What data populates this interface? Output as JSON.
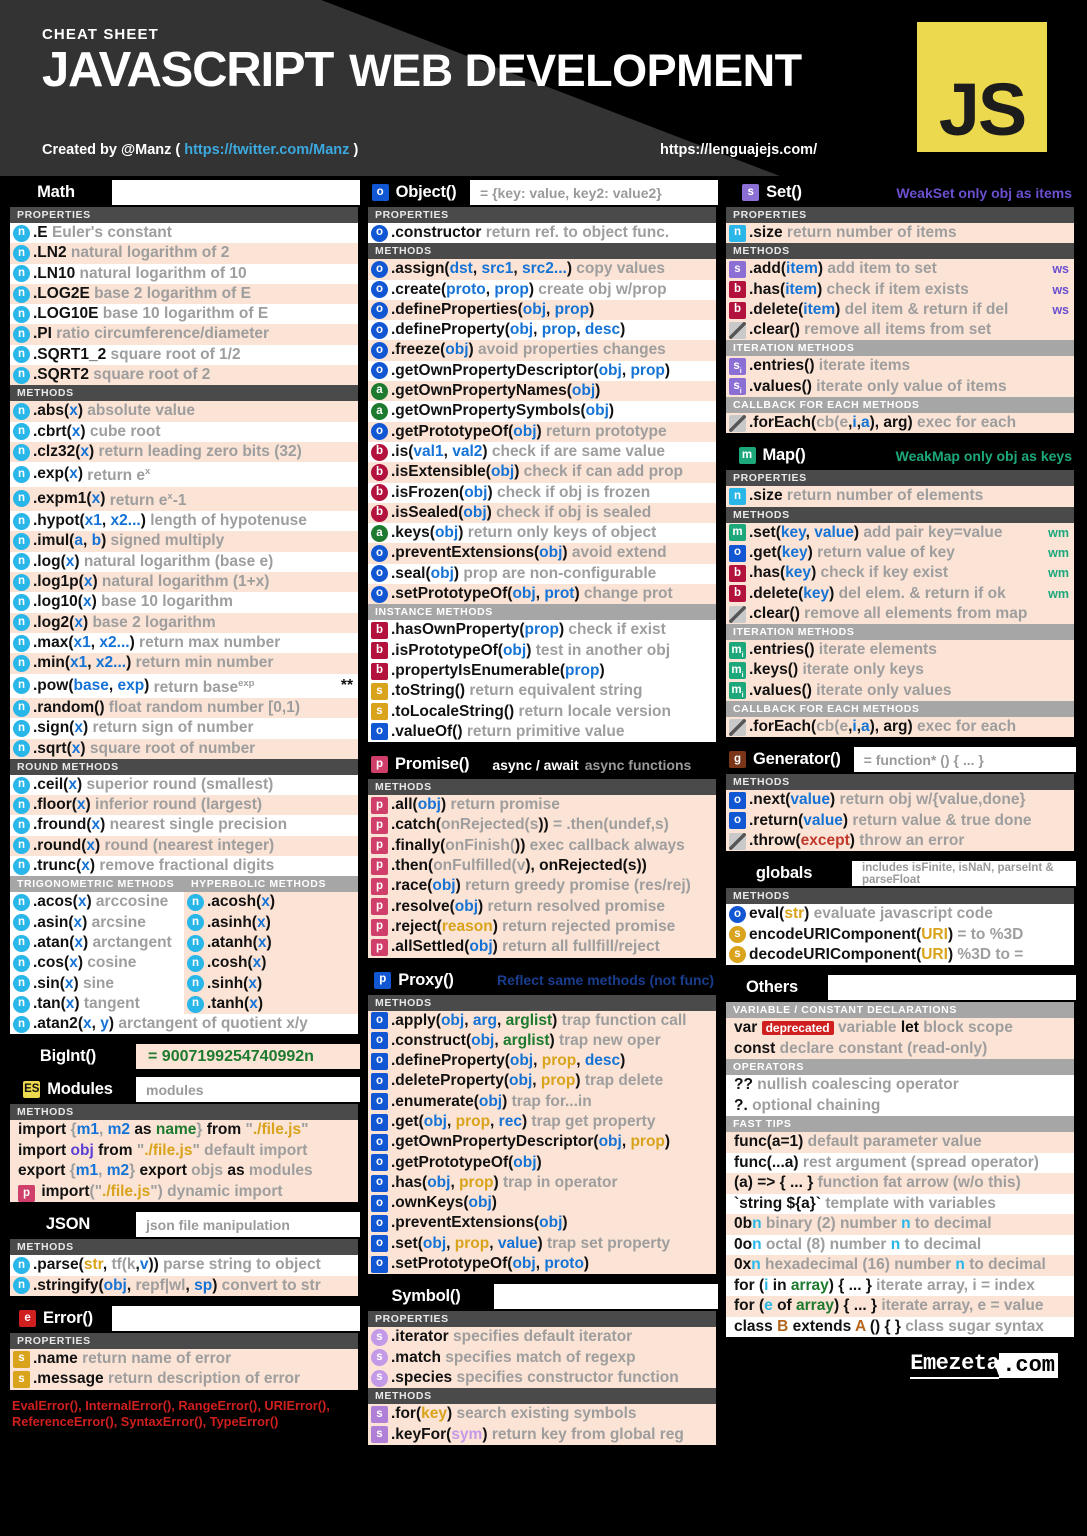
{
  "header": {
    "cheat_label": "CHEAT SHEET",
    "title_bold": "JAVASCRIPT",
    "title_light": "WEB DEVELOPMENT",
    "created_prefix": "Created by @Manz (",
    "created_link": "https://twitter.com/Manz",
    "created_suffix": ")",
    "site_url": "https://lenguajejs.com/",
    "js_logo": "JS"
  },
  "labels": {
    "properties": "PROPERTIES",
    "methods": "METHODS",
    "round_methods": "ROUND METHODS",
    "trig_methods": "TRIGONOMETRIC METHODS",
    "hyperbolic_methods": "HYPERBOLIC METHODS",
    "instance_methods": "INSTANCE METHODS",
    "iteration_methods": "ITERATION METHODS",
    "callback_methods": "CALLBACK FOR EACH METHODS",
    "var_const_decl": "VARIABLE / CONSTANT DECLARATIONS",
    "operators": "OPERATORS",
    "fast_tips": "FAST TIPS"
  },
  "math": {
    "title": "Math",
    "properties": [
      {
        "badge": "n",
        "name": ".E",
        "desc": "Euler's constant"
      },
      {
        "badge": "n",
        "name": ".LN2",
        "desc": "natural logarithm of 2"
      },
      {
        "badge": "n",
        "name": ".LN10",
        "desc": "natural logarithm of 10"
      },
      {
        "badge": "n",
        "name": ".LOG2E",
        "desc": "base 2 logarithm of E"
      },
      {
        "badge": "n",
        "name": ".LOG10E",
        "desc": "base 10 logarithm of E"
      },
      {
        "badge": "n",
        "name": ".PI",
        "desc": "ratio circumference/diameter"
      },
      {
        "badge": "n",
        "name": ".SQRT1_2",
        "desc": "square root of 1/2"
      },
      {
        "badge": "n",
        "name": ".SQRT2",
        "desc": "square root of 2"
      }
    ],
    "methods": [
      {
        "badge": "n",
        "name": ".abs(x)",
        "desc": "absolute value"
      },
      {
        "badge": "n",
        "name": ".cbrt(x)",
        "desc": "cube root"
      },
      {
        "badge": "n",
        "name": ".clz32(x)",
        "desc": "return leading zero bits (32)"
      },
      {
        "badge": "n",
        "name": ".exp(x)",
        "desc": "return e^x"
      },
      {
        "badge": "n",
        "name": ".expm1(x)",
        "desc": "return e^x-1"
      },
      {
        "badge": "n",
        "name": ".hypot(x1, x2...)",
        "desc": "length of hypotenuse"
      },
      {
        "badge": "n",
        "name": ".imul(a, b)",
        "desc": "signed multiply"
      },
      {
        "badge": "n",
        "name": ".log(x)",
        "desc": "natural logarithm (base e)"
      },
      {
        "badge": "n",
        "name": ".log1p(x)",
        "desc": "natural logarithm (1+x)"
      },
      {
        "badge": "n",
        "name": ".log10(x)",
        "desc": "base 10 logarithm"
      },
      {
        "badge": "n",
        "name": ".log2(x)",
        "desc": "base 2 logarithm"
      },
      {
        "badge": "n",
        "name": ".max(x1, x2...)",
        "desc": "return max number"
      },
      {
        "badge": "n",
        "name": ".min(x1, x2...)",
        "desc": "return min number"
      },
      {
        "badge": "n",
        "name": ".pow(base, exp)",
        "desc": "return base^exp",
        "tag": "**"
      },
      {
        "badge": "n",
        "name": ".random()",
        "desc": "float random number [0,1)"
      },
      {
        "badge": "n",
        "name": ".sign(x)",
        "desc": "return sign of number"
      },
      {
        "badge": "n",
        "name": ".sqrt(x)",
        "desc": "square root of number"
      }
    ],
    "round_methods": [
      {
        "badge": "n",
        "name": ".ceil(x)",
        "desc": "superior round (smallest)"
      },
      {
        "badge": "n",
        "name": ".floor(x)",
        "desc": "inferior round (largest)"
      },
      {
        "badge": "n",
        "name": ".fround(x)",
        "desc": "nearest single precision"
      },
      {
        "badge": "n",
        "name": ".round(x)",
        "desc": "round (nearest integer)"
      },
      {
        "badge": "n",
        "name": ".trunc(x)",
        "desc": "remove fractional digits"
      }
    ],
    "trig": [
      {
        "badge": "n",
        "name": ".acos(x)",
        "desc": "arccosine"
      },
      {
        "badge": "n",
        "name": ".asin(x)",
        "desc": "arcsine"
      },
      {
        "badge": "n",
        "name": ".atan(x)",
        "desc": "arctangent"
      },
      {
        "badge": "n",
        "name": ".cos(x)",
        "desc": "cosine"
      },
      {
        "badge": "n",
        "name": ".sin(x)",
        "desc": "sine"
      },
      {
        "badge": "n",
        "name": ".tan(x)",
        "desc": "tangent"
      }
    ],
    "hyperbolic": [
      {
        "badge": "n",
        "name": ".acosh(x)",
        "desc": ""
      },
      {
        "badge": "n",
        "name": ".asinh(x)",
        "desc": ""
      },
      {
        "badge": "n",
        "name": ".atanh(x)",
        "desc": ""
      },
      {
        "badge": "n",
        "name": ".cosh(x)",
        "desc": ""
      },
      {
        "badge": "n",
        "name": ".sinh(x)",
        "desc": ""
      },
      {
        "badge": "n",
        "name": ".tanh(x)",
        "desc": ""
      }
    ],
    "atan2": {
      "badge": "n",
      "name": ".atan2(x, y)",
      "desc": "arctangent of quotient x/y"
    }
  },
  "bigint": {
    "title": "BigInt()",
    "value": "= 9007199254740992n"
  },
  "modules": {
    "badge": "ES",
    "title": "Modules",
    "note": "modules",
    "rows": [
      "import {m1, m2 as name} from \"./file.js\"",
      "import obj from \"./file.js\" default import",
      "export {m1, m2} export objs as modules",
      "import(\"./file.js\") dynamic import"
    ]
  },
  "json": {
    "title": "JSON",
    "note": "json file manipulation",
    "methods": [
      {
        "badge": "n",
        "name": ".parse(str, tf(k,v))",
        "desc": "parse string to object"
      },
      {
        "badge": "n",
        "name": ".stringify(obj, repf|wl, sp)",
        "desc": "convert to str"
      }
    ]
  },
  "error": {
    "badge": "e",
    "title": "Error()",
    "properties": [
      {
        "badge": "s",
        "name": ".name",
        "desc": "return name of error"
      },
      {
        "badge": "s",
        "name": ".message",
        "desc": "return description of error"
      }
    ],
    "types_line1": "EvalError(), InternalError(), RangeError(), URIError(),",
    "types_line2": "ReferenceError(), SyntaxError(), TypeError()"
  },
  "object": {
    "badge": "o",
    "title": "Object()",
    "note": "= {key: value, key2: value2}",
    "properties": [
      {
        "badge": "o",
        "name": ".constructor",
        "desc": "return ref. to object func."
      }
    ],
    "methods": [
      {
        "badge": "o",
        "name": ".assign(dst, src1, src2...)",
        "desc": "copy values"
      },
      {
        "badge": "o",
        "name": ".create(proto, prop)",
        "desc": "create obj w/prop"
      },
      {
        "badge": "o",
        "name": ".defineProperties(obj, prop)",
        "desc": ""
      },
      {
        "badge": "o",
        "name": ".defineProperty(obj, prop, desc)",
        "desc": ""
      },
      {
        "badge": "o",
        "name": ".freeze(obj)",
        "desc": "avoid properties changes"
      },
      {
        "badge": "o",
        "name": ".getOwnPropertyDescriptor(obj, prop)",
        "desc": ""
      },
      {
        "badge": "a",
        "name": ".getOwnPropertyNames(obj)",
        "desc": ""
      },
      {
        "badge": "a",
        "name": ".getOwnPropertySymbols(obj)",
        "desc": ""
      },
      {
        "badge": "o",
        "name": ".getPrototypeOf(obj)",
        "desc": "return prototype"
      },
      {
        "badge": "b",
        "name": ".is(val1, val2)",
        "desc": "check if are same value"
      },
      {
        "badge": "b",
        "name": ".isExtensible(obj)",
        "desc": "check if can add prop"
      },
      {
        "badge": "b",
        "name": ".isFrozen(obj)",
        "desc": "check if obj is frozen"
      },
      {
        "badge": "b",
        "name": ".isSealed(obj)",
        "desc": "check if obj is sealed"
      },
      {
        "badge": "a",
        "name": ".keys(obj)",
        "desc": "return only keys of object"
      },
      {
        "badge": "o",
        "name": ".preventExtensions(obj)",
        "desc": "avoid extend"
      },
      {
        "badge": "o",
        "name": ".seal(obj)",
        "desc": "prop are non-configurable"
      },
      {
        "badge": "o",
        "name": ".setPrototypeOf(obj, prot)",
        "desc": "change prot"
      }
    ],
    "instance_methods": [
      {
        "badge": "b",
        "name": ".hasOwnProperty(prop)",
        "desc": "check if exist"
      },
      {
        "badge": "b",
        "name": ".isPrototypeOf(obj)",
        "desc": "test in another obj"
      },
      {
        "badge": "b",
        "name": ".propertyIsEnumerable(prop)",
        "desc": ""
      },
      {
        "badge": "s",
        "name": ".toString()",
        "desc": "return equivalent string"
      },
      {
        "badge": "s",
        "name": ".toLocaleString()",
        "desc": "return locale version"
      },
      {
        "badge": "o",
        "name": ".valueOf()",
        "desc": "return primitive value"
      }
    ]
  },
  "promise": {
    "badge": "p",
    "title": "Promise()",
    "note_bold": "async / await",
    "note": "async functions",
    "methods": [
      {
        "badge": "p",
        "name": ".all(obj)",
        "desc": "return promise"
      },
      {
        "badge": "p",
        "name": ".catch(onRejected(s))",
        "desc": "= .then(undef,s)"
      },
      {
        "badge": "p",
        "name": ".finally(onFinish())",
        "desc": "exec callback always"
      },
      {
        "badge": "p",
        "name": ".then(onFulfilled(v), onRejected(s))",
        "desc": ""
      },
      {
        "badge": "p",
        "name": ".race(obj)",
        "desc": "return greedy promise (res/rej)"
      },
      {
        "badge": "p",
        "name": ".resolve(obj)",
        "desc": "return resolved promise"
      },
      {
        "badge": "p",
        "name": ".reject(reason)",
        "desc": "return rejected promise"
      },
      {
        "badge": "p",
        "name": ".allSettled(obj)",
        "desc": "return all fullfill/reject"
      }
    ]
  },
  "proxy": {
    "badge": "p",
    "title": "Proxy()",
    "note": "Reflect same methods (not func)",
    "methods": [
      {
        "badge": "o",
        "name": ".apply(obj, arg, arglist)",
        "desc": "trap function call"
      },
      {
        "badge": "o",
        "name": ".construct(obj, arglist)",
        "desc": "trap new oper"
      },
      {
        "badge": "o",
        "name": ".defineProperty(obj, prop, desc)",
        "desc": ""
      },
      {
        "badge": "o",
        "name": ".deleteProperty(obj, prop)",
        "desc": "trap delete"
      },
      {
        "badge": "o",
        "name": ".enumerate(obj)",
        "desc": "trap for...in"
      },
      {
        "badge": "o",
        "name": ".get(obj, prop, rec)",
        "desc": "trap get property"
      },
      {
        "badge": "o",
        "name": ".getOwnPropertyDescriptor(obj, prop)",
        "desc": ""
      },
      {
        "badge": "o",
        "name": ".getPrototypeOf(obj)",
        "desc": ""
      },
      {
        "badge": "o",
        "name": ".has(obj, prop)",
        "desc": "trap in operator"
      },
      {
        "badge": "o",
        "name": ".ownKeys(obj)",
        "desc": ""
      },
      {
        "badge": "o",
        "name": ".preventExtensions(obj)",
        "desc": ""
      },
      {
        "badge": "o",
        "name": ".set(obj, prop, value)",
        "desc": "trap set property"
      },
      {
        "badge": "o",
        "name": ".setPrototypeOf(obj, proto)",
        "desc": ""
      }
    ]
  },
  "symbol": {
    "title": "Symbol()",
    "properties": [
      {
        "badge": "s",
        "name": ".iterator",
        "desc": "specifies default iterator"
      },
      {
        "badge": "s",
        "name": ".match",
        "desc": "specifies match of regexp"
      },
      {
        "badge": "s",
        "name": ".species",
        "desc": "specifies constructor function"
      }
    ],
    "methods": [
      {
        "badge": "s",
        "name": ".for(key)",
        "desc": "search existing symbols"
      },
      {
        "badge": "s",
        "name": ".keyFor(sym)",
        "desc": "return key from global reg"
      }
    ]
  },
  "set": {
    "badge": "s",
    "title": "Set()",
    "note": "WeakSet only obj as items",
    "properties": [
      {
        "badge": "n",
        "name": ".size",
        "desc": "return number of items"
      }
    ],
    "methods": [
      {
        "badge": "s",
        "name": ".add(item)",
        "desc": "add item to set",
        "tag": "ws"
      },
      {
        "badge": "b",
        "name": ".has(item)",
        "desc": "check if item exists",
        "tag": "ws"
      },
      {
        "badge": "b",
        "name": ".delete(item)",
        "desc": "del item & return if del",
        "tag": "ws"
      },
      {
        "badge": "na",
        "name": ".clear()",
        "desc": "remove all items from set"
      }
    ],
    "iteration_methods": [
      {
        "badge": "si",
        "name": ".entries()",
        "desc": "iterate items"
      },
      {
        "badge": "si",
        "name": ".values()",
        "desc": "iterate only value of items"
      }
    ],
    "callback_methods": [
      {
        "badge": "na",
        "name": ".forEach(cb(e,i,a), arg)",
        "desc": "exec for each"
      }
    ]
  },
  "map": {
    "badge": "m",
    "title": "Map()",
    "note": "WeakMap only obj as keys",
    "properties": [
      {
        "badge": "n",
        "name": ".size",
        "desc": "return number of elements"
      }
    ],
    "methods": [
      {
        "badge": "m",
        "name": ".set(key, value)",
        "desc": "add pair key=value",
        "tag": "wm"
      },
      {
        "badge": "o",
        "name": ".get(key)",
        "desc": "return value of key",
        "tag": "wm"
      },
      {
        "badge": "b",
        "name": ".has(key)",
        "desc": "check if key exist",
        "tag": "wm"
      },
      {
        "badge": "b",
        "name": ".delete(key)",
        "desc": "del elem. & return if ok",
        "tag": "wm"
      },
      {
        "badge": "na",
        "name": ".clear()",
        "desc": "remove all elements from map"
      }
    ],
    "iteration_methods": [
      {
        "badge": "mi",
        "name": ".entries()",
        "desc": "iterate elements"
      },
      {
        "badge": "mi",
        "name": ".keys()",
        "desc": "iterate only keys"
      },
      {
        "badge": "mi",
        "name": ".values()",
        "desc": "iterate only values"
      }
    ],
    "callback_methods": [
      {
        "badge": "na",
        "name": ".forEach(cb(e,i,a), arg)",
        "desc": "exec for each"
      }
    ]
  },
  "generator": {
    "badge": "g",
    "title": "Generator()",
    "note": "= function* () { ... }",
    "methods": [
      {
        "badge": "o",
        "name": ".next(value)",
        "desc": "return obj w/{value,done}"
      },
      {
        "badge": "o",
        "name": ".return(value)",
        "desc": "return value & true done"
      },
      {
        "badge": "na",
        "name": ".throw(except)",
        "desc": "throw an error"
      }
    ]
  },
  "globals": {
    "title": "globals",
    "note": "includes isFinite, isNaN, parseInt & parseFloat",
    "methods": [
      {
        "badge": "o",
        "name": "eval(str)",
        "desc": "evaluate javascript code"
      },
      {
        "badge": "s",
        "name": "encodeURIComponent(URI)",
        "desc": "= to %3D"
      },
      {
        "badge": "s",
        "name": "decodeURIComponent(URI)",
        "desc": "%3D to ="
      }
    ]
  },
  "others": {
    "title": "Others",
    "declarations": [
      "var deprecated variable  let block scope",
      "const declare constant (read-only)"
    ],
    "operators": [
      "?? nullish coalescing operator",
      "?. optional chaining"
    ],
    "fast_tips": [
      "func(a=1) default parameter value",
      "func(...a) rest argument (spread operator)",
      "(a) => { ... } function fat arrow (w/o this)",
      "`string ${a}` template with variables",
      "0bn binary (2) number n to decimal",
      "0on octal (8) number n to decimal",
      "0xn hexadecimal (16) number n to decimal",
      "for (i in array) { ... } iterate array, i = index",
      "for (e of array) { ... } iterate array, e = value",
      "class B extends A () { } class sugar syntax"
    ],
    "deprecated_tag": "deprecated"
  },
  "footer": {
    "logo_a": "Emezeta",
    "logo_b": ".com"
  }
}
